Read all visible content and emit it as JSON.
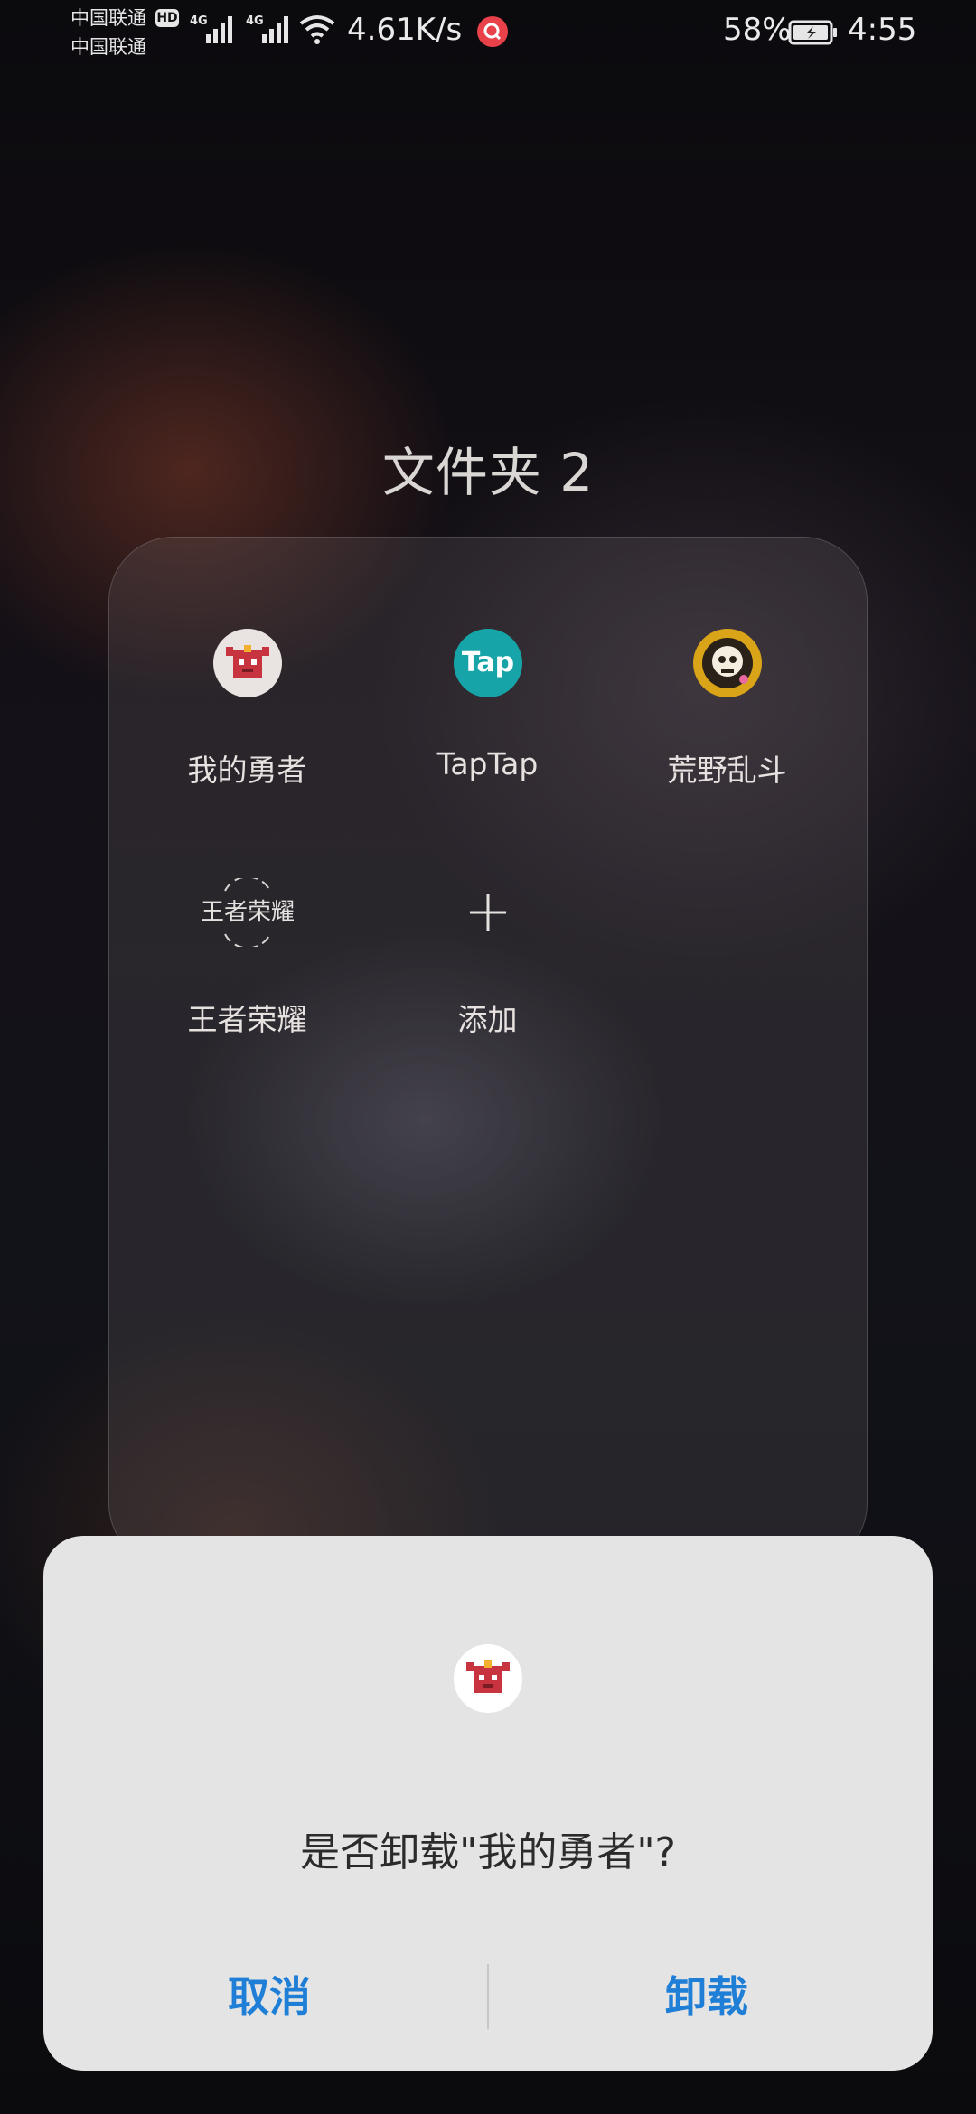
{
  "status_bar": {
    "carrier_1": "中国联通",
    "carrier_2": "中国联通",
    "hd_badge": "HD",
    "network_1": "4G",
    "network_2": "4G",
    "net_speed": "4.61K/s",
    "battery_percent": "58%",
    "time": "4:55"
  },
  "folder": {
    "title": "文件夹 2",
    "apps": [
      {
        "label": "我的勇者",
        "icon": "brave-hero-icon"
      },
      {
        "label": "TapTap",
        "icon_text": "Tap",
        "icon": "taptap-icon"
      },
      {
        "label": "荒野乱斗",
        "icon": "brawl-stars-icon"
      },
      {
        "label": "王者荣耀",
        "icon_text": "王者荣耀",
        "icon": "honor-of-kings-icon"
      },
      {
        "label": "添加",
        "icon": "add-icon"
      }
    ]
  },
  "dialog": {
    "message": "是否卸载\"我的勇者\"?",
    "cancel_label": "取消",
    "confirm_label": "卸载",
    "accent_color": "#1f7ed6"
  }
}
